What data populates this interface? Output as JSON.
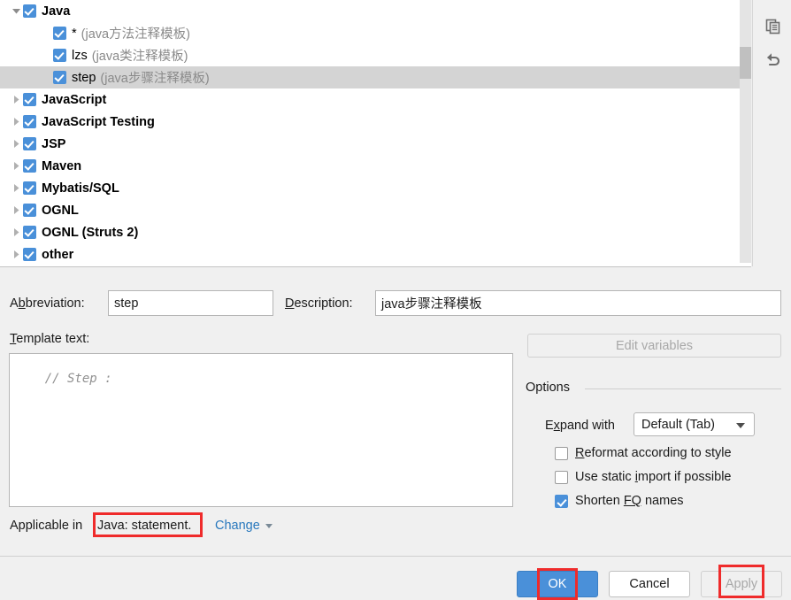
{
  "tree": {
    "nodes": [
      {
        "label": "Java",
        "desc": "",
        "level": 0,
        "bold": true,
        "expanded": true,
        "checked": true,
        "selected": false,
        "twisty": "chevron-down-icon"
      },
      {
        "label": "*",
        "desc": "(java方法注释模板)",
        "level": 1,
        "bold": false,
        "expanded": false,
        "checked": true,
        "selected": false,
        "twisty": "none"
      },
      {
        "label": "lzs",
        "desc": "(java类注释模板)",
        "level": 1,
        "bold": false,
        "expanded": false,
        "checked": true,
        "selected": false,
        "twisty": "none"
      },
      {
        "label": "step",
        "desc": "(java步骤注释模板)",
        "level": 1,
        "bold": false,
        "expanded": false,
        "checked": true,
        "selected": true,
        "twisty": "none"
      },
      {
        "label": "JavaScript",
        "desc": "",
        "level": 0,
        "bold": true,
        "expanded": false,
        "checked": true,
        "selected": false,
        "twisty": "chevron-right-icon"
      },
      {
        "label": "JavaScript Testing",
        "desc": "",
        "level": 0,
        "bold": true,
        "expanded": false,
        "checked": true,
        "selected": false,
        "twisty": "chevron-right-icon"
      },
      {
        "label": "JSP",
        "desc": "",
        "level": 0,
        "bold": true,
        "expanded": false,
        "checked": true,
        "selected": false,
        "twisty": "chevron-right-icon"
      },
      {
        "label": "Maven",
        "desc": "",
        "level": 0,
        "bold": true,
        "expanded": false,
        "checked": true,
        "selected": false,
        "twisty": "chevron-right-icon"
      },
      {
        "label": "Mybatis/SQL",
        "desc": "",
        "level": 0,
        "bold": true,
        "expanded": false,
        "checked": true,
        "selected": false,
        "twisty": "chevron-right-icon"
      },
      {
        "label": "OGNL",
        "desc": "",
        "level": 0,
        "bold": true,
        "expanded": false,
        "checked": true,
        "selected": false,
        "twisty": "chevron-right-icon"
      },
      {
        "label": "OGNL (Struts 2)",
        "desc": "",
        "level": 0,
        "bold": true,
        "expanded": false,
        "checked": true,
        "selected": false,
        "twisty": "chevron-right-icon"
      },
      {
        "label": "other",
        "desc": "",
        "level": 0,
        "bold": true,
        "expanded": false,
        "checked": true,
        "selected": false,
        "twisty": "chevron-right-icon"
      }
    ]
  },
  "side_toolbar": {
    "buttons": [
      {
        "icon": "copy-icon",
        "title": "Duplicate"
      },
      {
        "icon": "undo-icon",
        "title": "Restore defaults"
      }
    ]
  },
  "form": {
    "abbreviation_label_pre": "A",
    "abbreviation_label_mn": "b",
    "abbreviation_label_post": "breviation:",
    "abbreviation_value": "step",
    "description_label_mn": "D",
    "description_label_post": "escription:",
    "description_value": "java步骤注释模板",
    "template_text_label_mn": "T",
    "template_text_label_post": "emplate text:",
    "template_text_value": "// Step : ",
    "edit_variables_label": "Edit variables",
    "applicable_in_label_pre": "Applicable in",
    "applicable_in_value": "Java: statement.",
    "change_link_label": "Change"
  },
  "options": {
    "title": "Options",
    "expand_with_label_pre": "E",
    "expand_with_label_mn": "x",
    "expand_with_label_post": "pand with",
    "expand_with_value": "Default (Tab)",
    "checkboxes": [
      {
        "label_pre": "",
        "label_mn": "R",
        "label_post": "eformat according to style",
        "checked": false
      },
      {
        "label_pre": "Use static ",
        "label_mn": "i",
        "label_post": "mport if possible",
        "checked": false
      },
      {
        "label_pre": "Shorten ",
        "label_mn": "FQ",
        "label_post": " names",
        "checked": true
      }
    ]
  },
  "footer": {
    "ok_label": "OK",
    "cancel_label": "Cancel",
    "apply_label": "Apply"
  },
  "colors": {
    "accent": "#4a90d9",
    "link": "#2878bd",
    "annotation": "#ef2b2b",
    "panel_bg": "#f0f0f0",
    "selected_row": "#d4d4d4"
  }
}
